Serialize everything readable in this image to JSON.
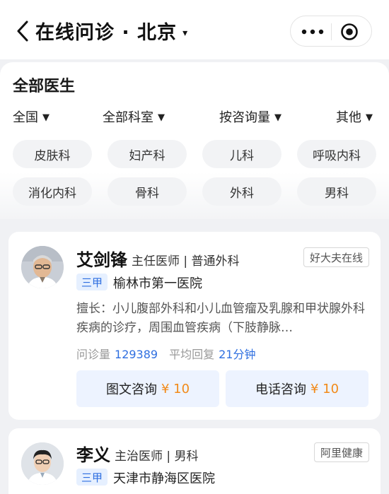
{
  "header": {
    "title": "在线问诊 · 北京",
    "caret": "▾"
  },
  "filters": {
    "section_title": "全部医生",
    "dropdowns": [
      "全国",
      "全部科室",
      "按咨询量",
      "其他"
    ],
    "dropdown_caret": "▼",
    "chips": [
      "皮肤科",
      "妇产科",
      "儿科",
      "呼吸内科",
      "消化内科",
      "骨科",
      "外科",
      "男科"
    ]
  },
  "doctors": [
    {
      "name": "艾剑锋",
      "title": "主任医师",
      "department": "普通外科",
      "platform": "好大夫在线",
      "grade": "三甲",
      "hospital": "榆林市第一医院",
      "specialty": "擅长：小儿腹部外科和小儿血管瘤及乳腺和甲状腺外科疾病的诊疗，周围血管疾病（下肢静脉…",
      "stats_label_1": "问诊量",
      "consult_count": "129389",
      "stats_label_2": "平均回复",
      "avg_reply": "21分钟",
      "btn_text_label": "图文咨询",
      "btn_text_price": "¥ 10",
      "btn_phone_label": "电话咨询",
      "btn_phone_price": "¥ 10"
    },
    {
      "name": "李义",
      "title": "主治医师",
      "department": "男科",
      "platform": "阿里健康",
      "grade": "三甲",
      "hospital": "天津市静海区医院"
    }
  ],
  "colors": {
    "accent": "#2f6fe0",
    "price": "#f28a19",
    "chip_bg": "#f2f3f5",
    "button_bg": "#edf3ff"
  },
  "icons": {
    "back": "chevron-left-icon",
    "more": "more-dots-icon",
    "target": "target-circle-icon"
  }
}
